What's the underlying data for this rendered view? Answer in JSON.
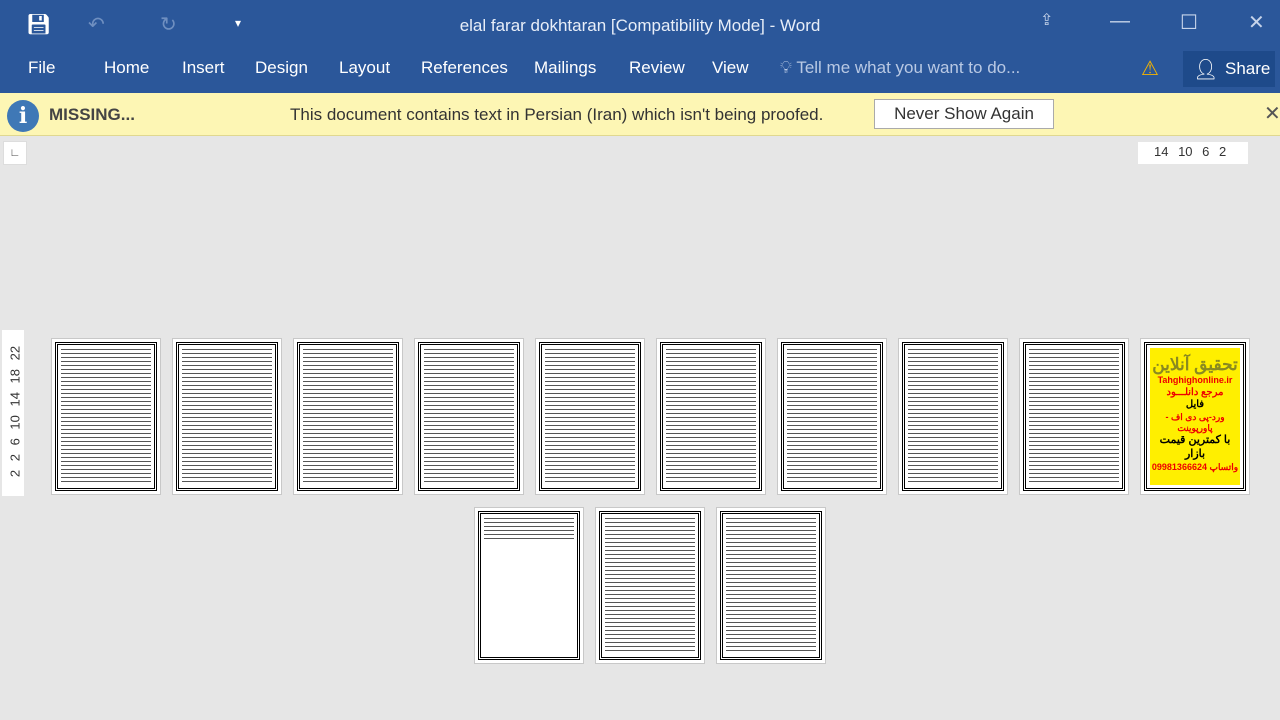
{
  "window": {
    "title": "elal farar dokhtaran [Compatibility Mode] - Word"
  },
  "ribbon": {
    "tabs": [
      "File",
      "Home",
      "Insert",
      "Design",
      "Layout",
      "References",
      "Mailings",
      "Review",
      "View"
    ],
    "tell_me": "Tell me what you want to do...",
    "share": "Share"
  },
  "message_bar": {
    "label": "MISSING...",
    "text": "This document contains text in Persian (Iran) which isn't being proofed.",
    "button": "Never Show Again"
  },
  "rulers": {
    "horizontal": "14 10 6 2",
    "vertical": "2 2 6 10 14 18 22"
  },
  "pages": {
    "count": 13,
    "ad": {
      "title": "تحقیق آنلاین",
      "site": "Tahghighonline.ir",
      "line1": "مرجع دانلـــود",
      "line2": "فایل",
      "line3": "ورد-پی دی اف - پاورپوینت",
      "line4": "با کمترین قیمت بازار",
      "line5": "09981366624 واتساپ"
    }
  },
  "colors": {
    "ribbon": "#2b579a",
    "message_bar": "#fdf6b4",
    "ad_bg": "#ffef00"
  }
}
